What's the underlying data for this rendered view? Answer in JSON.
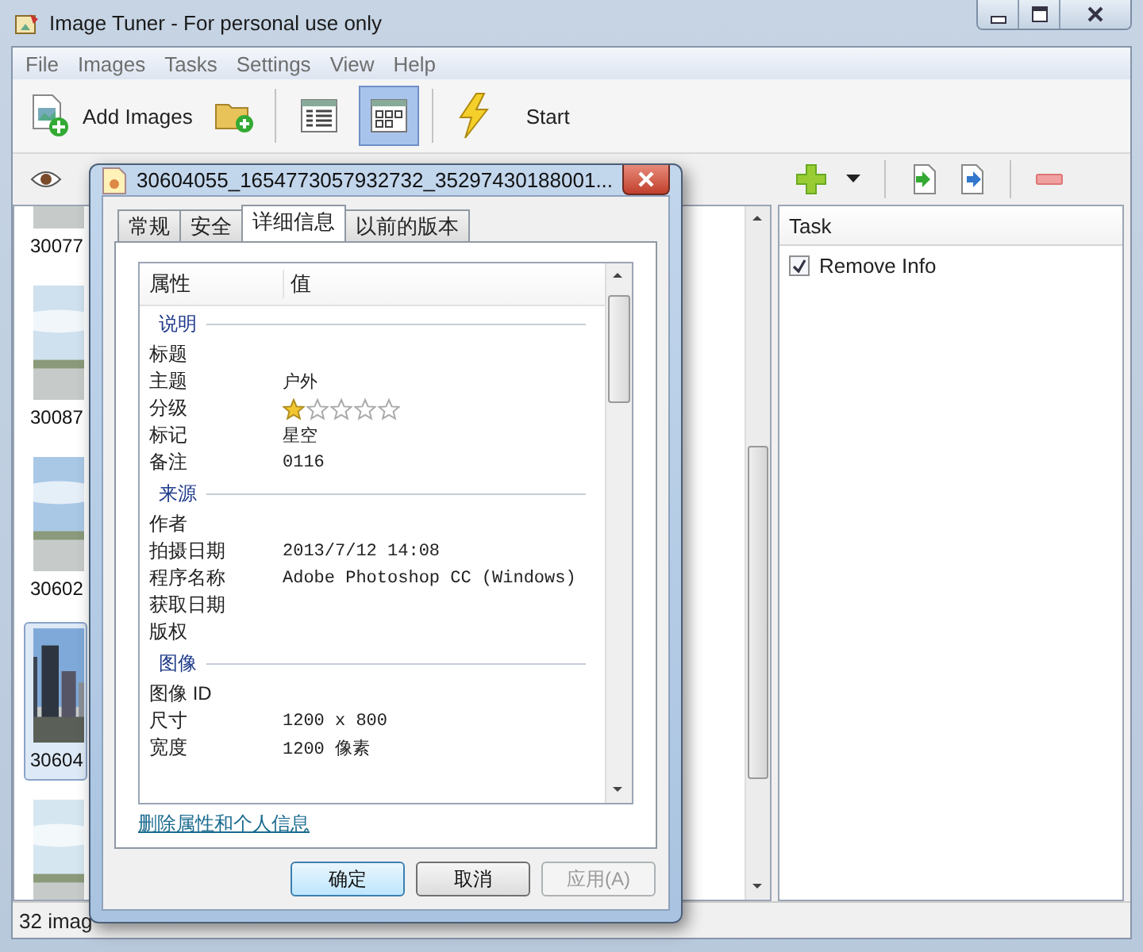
{
  "window": {
    "title": "Image Tuner - For personal use only"
  },
  "menu": [
    "File",
    "Images",
    "Tasks",
    "Settings",
    "View",
    "Help"
  ],
  "toolbar": {
    "add_images": "Add Images",
    "views": [
      {
        "kind": "list",
        "selected": false
      },
      {
        "kind": "thumbnails",
        "selected": true
      }
    ],
    "start": "Start"
  },
  "thumbnails": [
    {
      "label": "30077",
      "selected": false
    },
    {
      "label": "30087",
      "selected": false
    },
    {
      "label": "30602",
      "selected": false
    },
    {
      "label": "30604",
      "selected": true
    },
    {
      "selected": false
    }
  ],
  "task_panel": {
    "header": "Task",
    "tasks": [
      {
        "label": "Remove Info",
        "checked": true
      }
    ]
  },
  "status_bar": "32 imag",
  "dialog": {
    "title": "30604055_1654773057932732_35297430188001...",
    "tabs": [
      {
        "label": "常规",
        "selected": false
      },
      {
        "label": "安全",
        "selected": false
      },
      {
        "label": "详细信息",
        "selected": true
      },
      {
        "label": "以前的版本",
        "selected": false
      }
    ],
    "columns": [
      "属性",
      "值"
    ],
    "rows": [
      {
        "kind": "section",
        "label": "说明"
      },
      {
        "kind": "property",
        "name": "标题"
      },
      {
        "kind": "property",
        "name": "主题",
        "value": "户外"
      },
      {
        "kind": "rating",
        "name": "分级",
        "stars": 1
      },
      {
        "kind": "property",
        "name": "标记",
        "value": "星空"
      },
      {
        "kind": "property",
        "name": "备注",
        "value": "0116"
      },
      {
        "kind": "section",
        "label": "来源"
      },
      {
        "kind": "property",
        "name": "作者"
      },
      {
        "kind": "property",
        "name": "拍摄日期",
        "value": "2013/7/12 14:08"
      },
      {
        "kind": "property",
        "name": "程序名称",
        "value": "Adobe Photoshop CC (Windows)"
      },
      {
        "kind": "property",
        "name": "获取日期"
      },
      {
        "kind": "property",
        "name": "版权"
      },
      {
        "kind": "section",
        "label": "图像"
      },
      {
        "kind": "property",
        "name": "图像 ID"
      },
      {
        "kind": "property",
        "name": "尺寸",
        "value": "1200 x 800"
      },
      {
        "kind": "property",
        "name": "宽度",
        "value": "1200 像素"
      }
    ],
    "link": "删除属性和个人信息",
    "buttons": [
      {
        "label": "确定",
        "default": true,
        "disabled": false
      },
      {
        "label": "取消",
        "default": false,
        "disabled": false
      },
      {
        "label": "应用(A)",
        "default": false,
        "disabled": true
      }
    ]
  }
}
